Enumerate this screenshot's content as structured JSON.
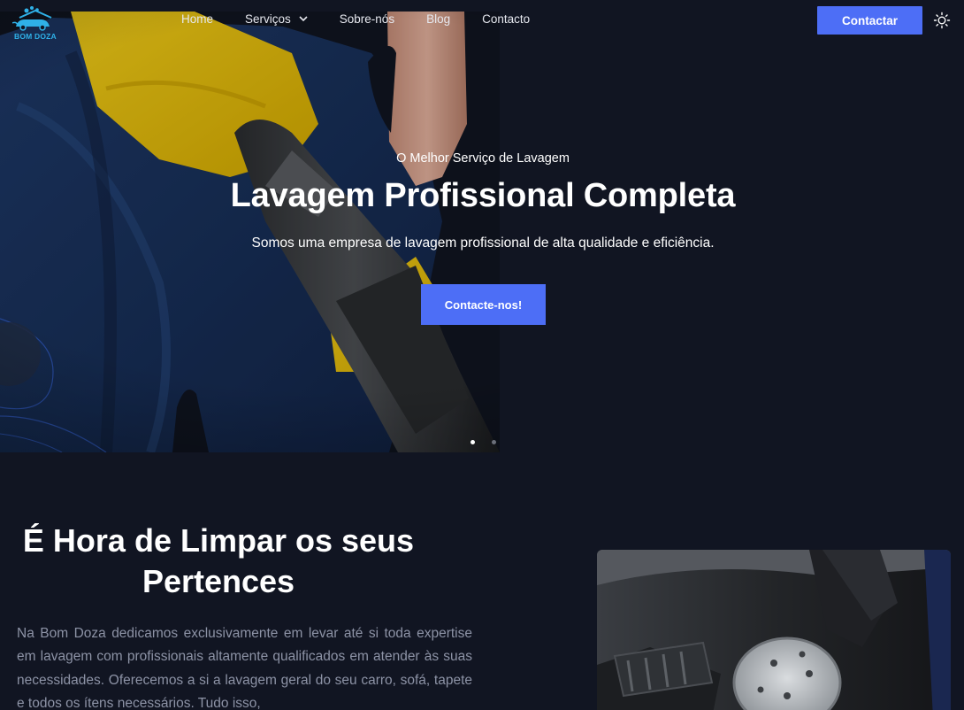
{
  "nav": {
    "logo_text": "BOM DOZA",
    "links": [
      {
        "label": "Home"
      },
      {
        "label": "Serviços"
      },
      {
        "label": "Sobre-nós"
      },
      {
        "label": "Blog"
      },
      {
        "label": "Contacto"
      }
    ],
    "contact_label": "Contactar"
  },
  "hero": {
    "subtitle": "O Melhor Serviço de Lavagem",
    "title": "Lavagem Profissional Completa",
    "description": "Somos uma empresa de lavagem profissional de alta qualidade e eficiência.",
    "button_label": "Contacte-nos!",
    "slides": 2,
    "active_slide": 1
  },
  "about": {
    "title_line1": "É Hora de Limpar os seus",
    "title_line2": "Pertences",
    "text": "Na Bom Doza dedicamos exclusivamente em levar até si toda expertise em lavagem com profissionais altamente qualificados em atender às suas necessidades. Oferecemos a si a lavagem geral do seu carro, sofá, tapete e todos os ítens necessários. Tudo isso,"
  },
  "colors": {
    "background": "#111522",
    "accent": "#4d6ef6",
    "logo": "#2fb1e8",
    "muted_text": "#8d93a6"
  },
  "icons": {
    "logo": "car-wash-logo-icon",
    "services_dropdown": "chevron-down-icon",
    "theme_toggle": "sun-icon"
  }
}
